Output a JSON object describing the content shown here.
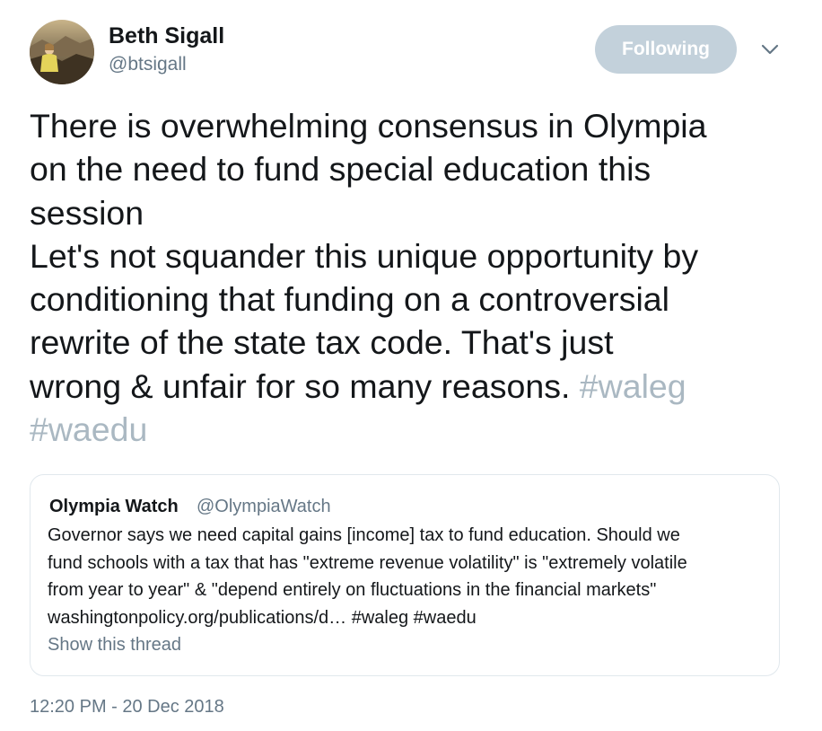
{
  "author": {
    "name": "Beth Sigall",
    "handle": "@btsigall",
    "avatar": "profile-photo"
  },
  "follow_button": {
    "label": "Following"
  },
  "menu": {
    "icon": "chevron-down-icon"
  },
  "tweet": {
    "lines": [
      "There is overwhelming consensus in Olympia",
      "on the need to fund special education this",
      "session",
      "Let's not squander this unique opportunity by",
      "conditioning that funding on a controversial",
      "rewrite of the state tax code. That's just",
      "wrong & unfair for so many reasons."
    ],
    "hashtag_1": "#waleg",
    "hashtag_2": "#waedu"
  },
  "quoted_tweet": {
    "name": "Olympia Watch",
    "handle": "@OlympiaWatch",
    "lines": [
      "Governor says we need capital gains [income] tax to fund education. Should we",
      "fund schools with a tax that has \"extreme revenue volatility\" is \"extremely volatile",
      "from year to year\" & \"depend entirely on fluctuations in the financial markets\"",
      "washingtonpolicy.org/publications/d… #waleg #waedu"
    ],
    "show_thread": "Show this thread"
  },
  "timestamp": "12:20 PM - 20 Dec 2018",
  "colors": {
    "text": "#14171a",
    "secondary": "#657786",
    "hashtag": "#aab8c2",
    "follow_button_bg": "#c3d1db",
    "border": "#e1e8ed"
  }
}
